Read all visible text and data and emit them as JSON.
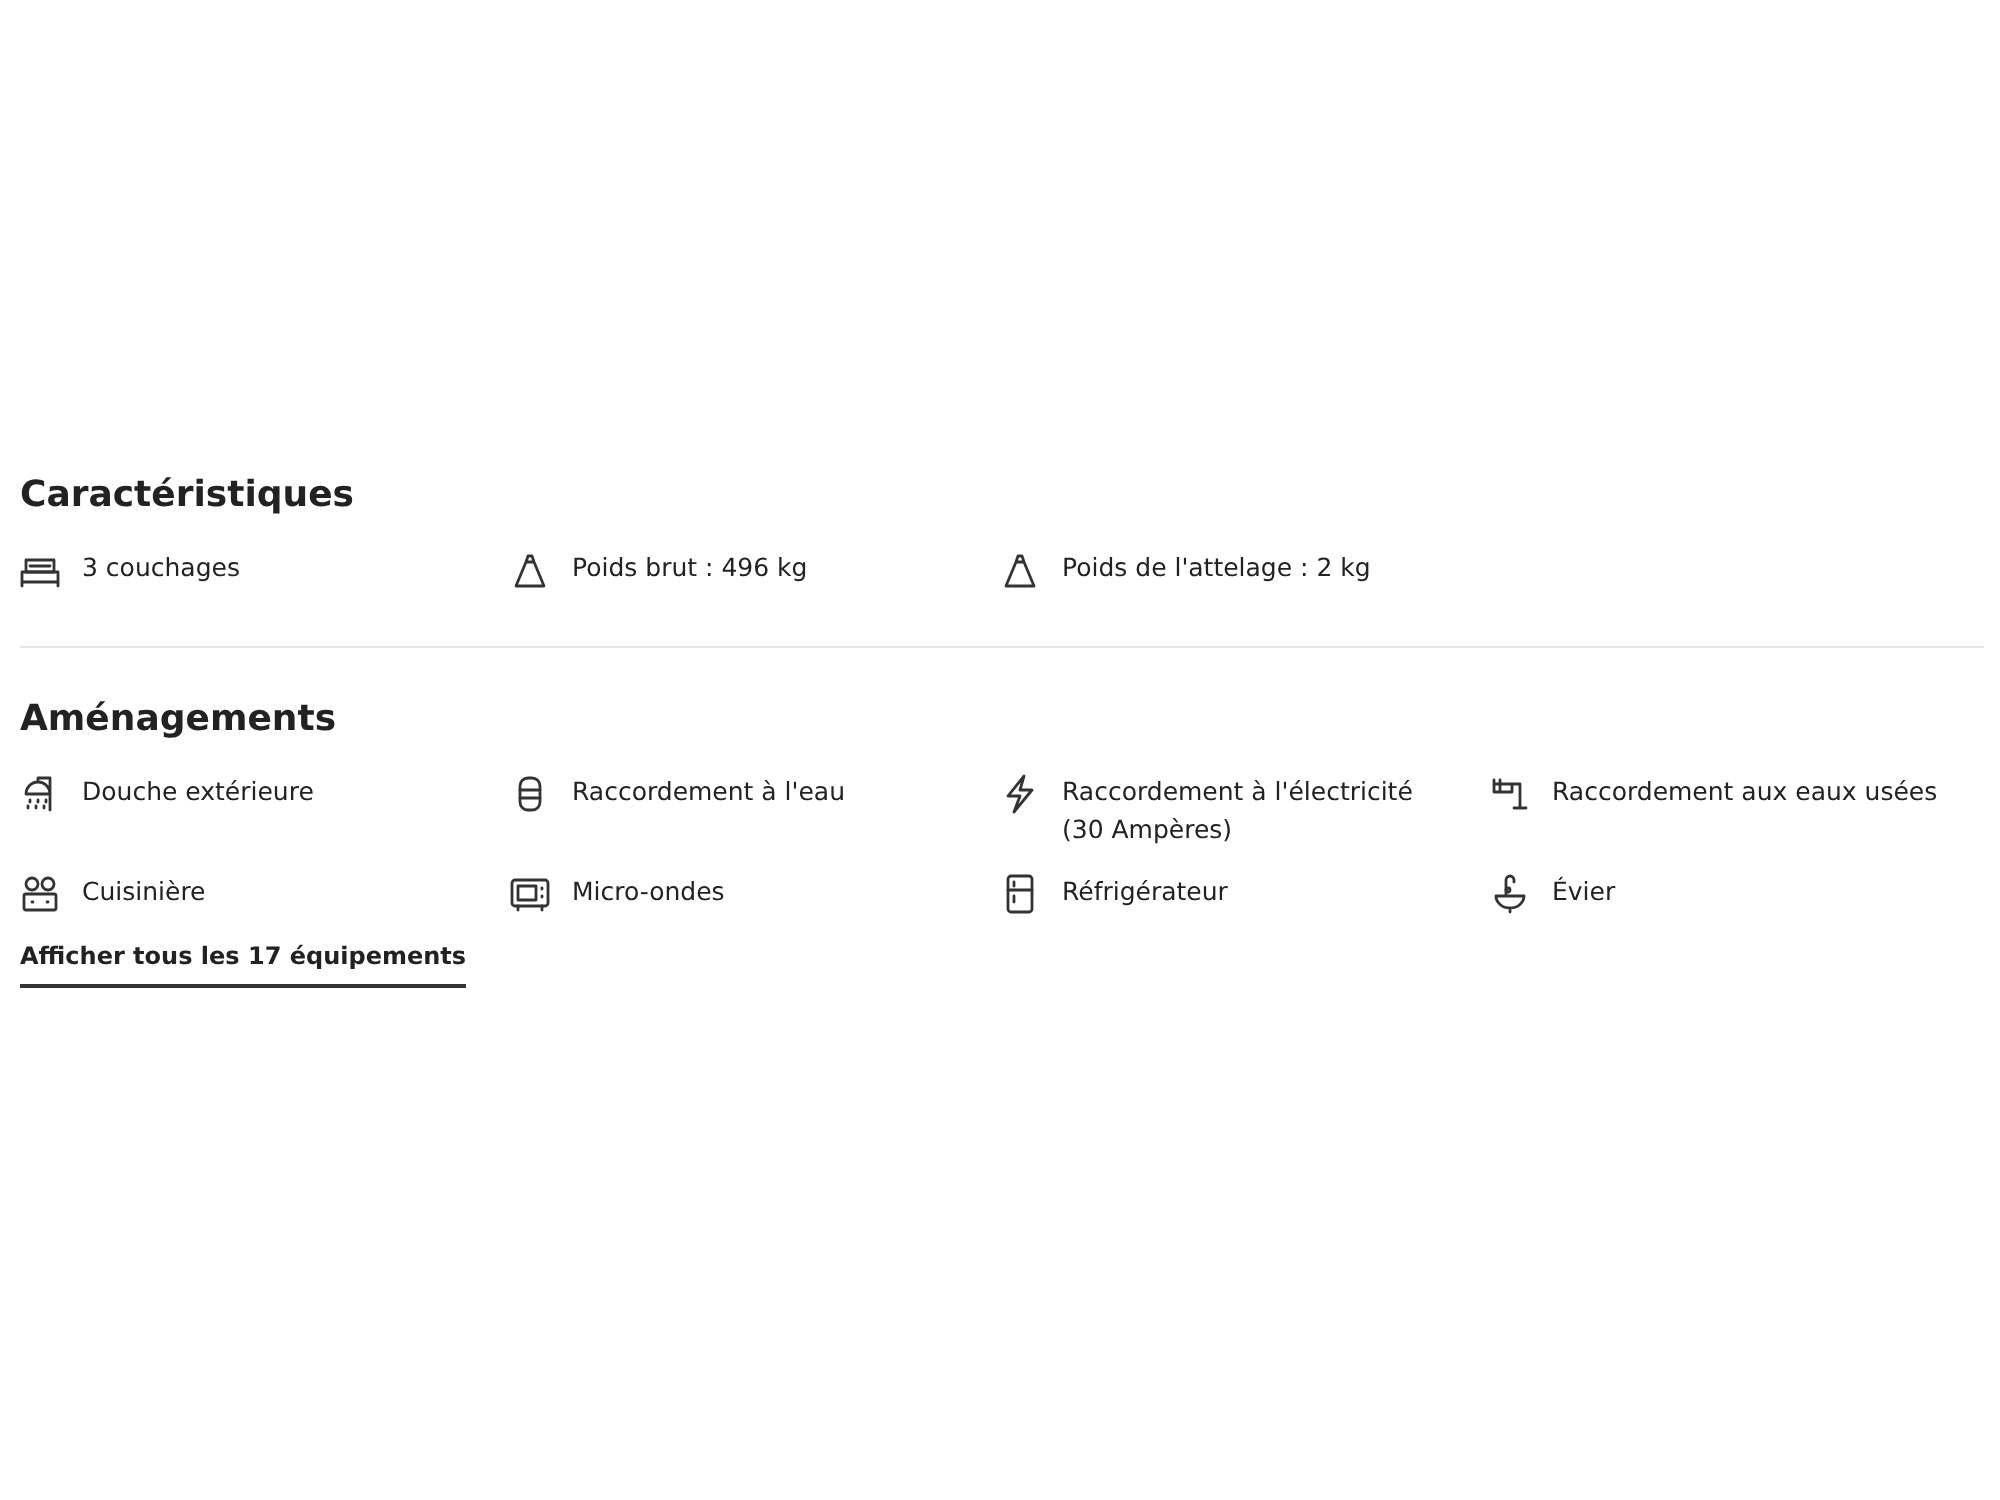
{
  "characteristics": {
    "title": "Caractéristiques",
    "items": [
      {
        "label": "3 couchages"
      },
      {
        "label": "Poids brut : 496 kg"
      },
      {
        "label": "Poids de l'attelage : 2 kg"
      }
    ]
  },
  "amenities": {
    "title": "Aménagements",
    "items": [
      {
        "label": "Douche extérieure"
      },
      {
        "label": "Raccordement à l'eau"
      },
      {
        "label": "Raccordement à l'électricité (30 Ampères)"
      },
      {
        "label": "Raccordement aux eaux usées"
      },
      {
        "label": "Cuisinière"
      },
      {
        "label": "Micro-ondes"
      },
      {
        "label": "Réfrigérateur"
      },
      {
        "label": "Évier"
      }
    ],
    "show_all_link": "Afficher tous les 17 équipements"
  }
}
